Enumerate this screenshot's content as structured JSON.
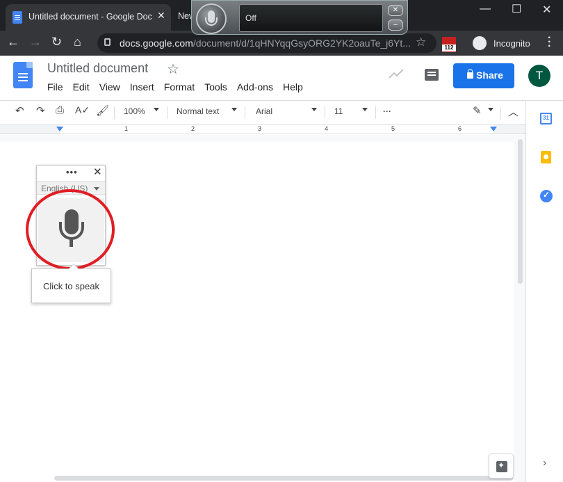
{
  "browser": {
    "active_tab_title": "Untitled document - Google Docs",
    "other_tab_title": "New",
    "url_host": "docs.google.com",
    "url_path": "/document/d/1qHNYqqGsyORG2YK2oauTe_j6Yt...",
    "extension_badge": "112",
    "incognito_label": "Incognito",
    "icons": [
      "back-icon",
      "forward-icon",
      "reload-icon",
      "home-icon",
      "lock-icon",
      "star-icon",
      "incognito-icon",
      "menu-dots-icon"
    ]
  },
  "speech_widget": {
    "status": "Off",
    "close_glyph": "✕",
    "minimize_glyph": "–"
  },
  "docs": {
    "title": "Untitled document",
    "menu": [
      "File",
      "Edit",
      "View",
      "Insert",
      "Format",
      "Tools",
      "Add-ons",
      "Help"
    ],
    "share_label": "Share",
    "avatar_initial": "T",
    "accent_color": "#1a73e8"
  },
  "toolbar": {
    "zoom": "100%",
    "style": "Normal text",
    "font": "Arial",
    "size": "11",
    "more": "···"
  },
  "ruler": {
    "numbers": [
      "1",
      "2",
      "3",
      "4",
      "5",
      "6"
    ]
  },
  "side_panel": {
    "calendar_day": "31"
  },
  "voice_typing": {
    "language": "English (US)",
    "tooltip": "Click to speak",
    "dots": "•••",
    "close": "✕"
  }
}
